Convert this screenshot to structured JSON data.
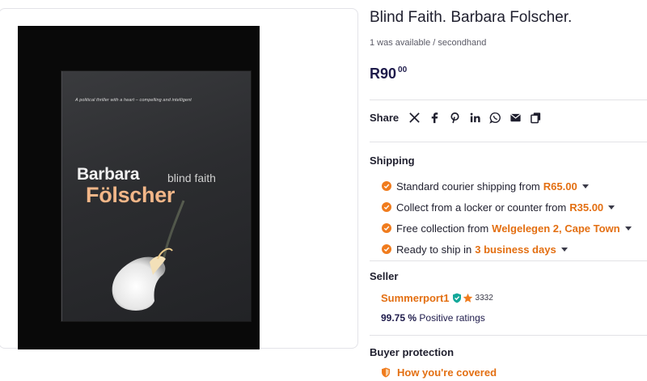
{
  "product": {
    "title": "Blind Faith. Barbara Folscher.",
    "availability": "1 was available / secondhand",
    "price_main": "R90",
    "price_cents": "00"
  },
  "book_cover": {
    "tagline": "A political thriller with a heart – compelling and intelligent",
    "author_first": "Barbara",
    "author_last": "Fölscher",
    "title": "blind faith"
  },
  "share": {
    "label": "Share",
    "icons": [
      "x-icon",
      "facebook-icon",
      "pinterest-icon",
      "linkedin-icon",
      "whatsapp-icon",
      "email-icon",
      "copy-icon"
    ]
  },
  "shipping": {
    "label": "Shipping",
    "items": [
      {
        "text": "Standard courier shipping from",
        "accent": "R65.00"
      },
      {
        "text": "Collect from a locker or counter from",
        "accent": "R35.00"
      },
      {
        "text": "Free collection from",
        "accent": "Welgelegen 2, Cape Town"
      },
      {
        "text": "Ready to ship in",
        "accent": "3 business days"
      }
    ]
  },
  "seller": {
    "label": "Seller",
    "name": "Summerport1",
    "rating_count": "3332",
    "positive_value": "99.75 %",
    "positive_label": "Positive ratings"
  },
  "buyer_protection": {
    "label": "Buyer protection",
    "link": "How you're covered"
  },
  "colors": {
    "accent": "#e36f12",
    "price": "#1e1b4b",
    "check": "#f07c1e",
    "verified": "#14a89a"
  }
}
